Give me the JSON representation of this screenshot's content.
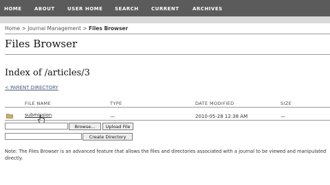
{
  "nav": {
    "items": [
      "HOME",
      "ABOUT",
      "USER HOME",
      "SEARCH",
      "CURRENT",
      "ARCHIVES"
    ]
  },
  "breadcrumb": {
    "home": "Home",
    "sep1": ">",
    "journal_mgmt": "Journal Management",
    "sep2": ">",
    "current": "Files Browser"
  },
  "page": {
    "title": "Files Browser",
    "index_title": "Index of /articles/3",
    "parent_link": "< PARENT DIRECTORY"
  },
  "table": {
    "headers": [
      "FILE NAME",
      "TYPE",
      "DATE MODIFIED",
      "SIZE"
    ],
    "rows": [
      {
        "name": "submission",
        "type": "—",
        "date": "2010-05-28 12:38 AM",
        "size": "—"
      }
    ]
  },
  "upload": {
    "file_value": "",
    "browse_label": "Browse...",
    "upload_label": "Upload File",
    "dir_value": "",
    "create_dir_label": "Create Directory"
  },
  "note": "Note: The Files Browser is an advanced feature that allows the files and directories associated with a journal to be viewed and manipulated directly.",
  "icons": {
    "folder": "folder-icon",
    "cursor": "hand-cursor-icon"
  },
  "colors": {
    "navbar": "#5b5b5b",
    "band": "#dadada",
    "link": "#4a5a7a"
  }
}
